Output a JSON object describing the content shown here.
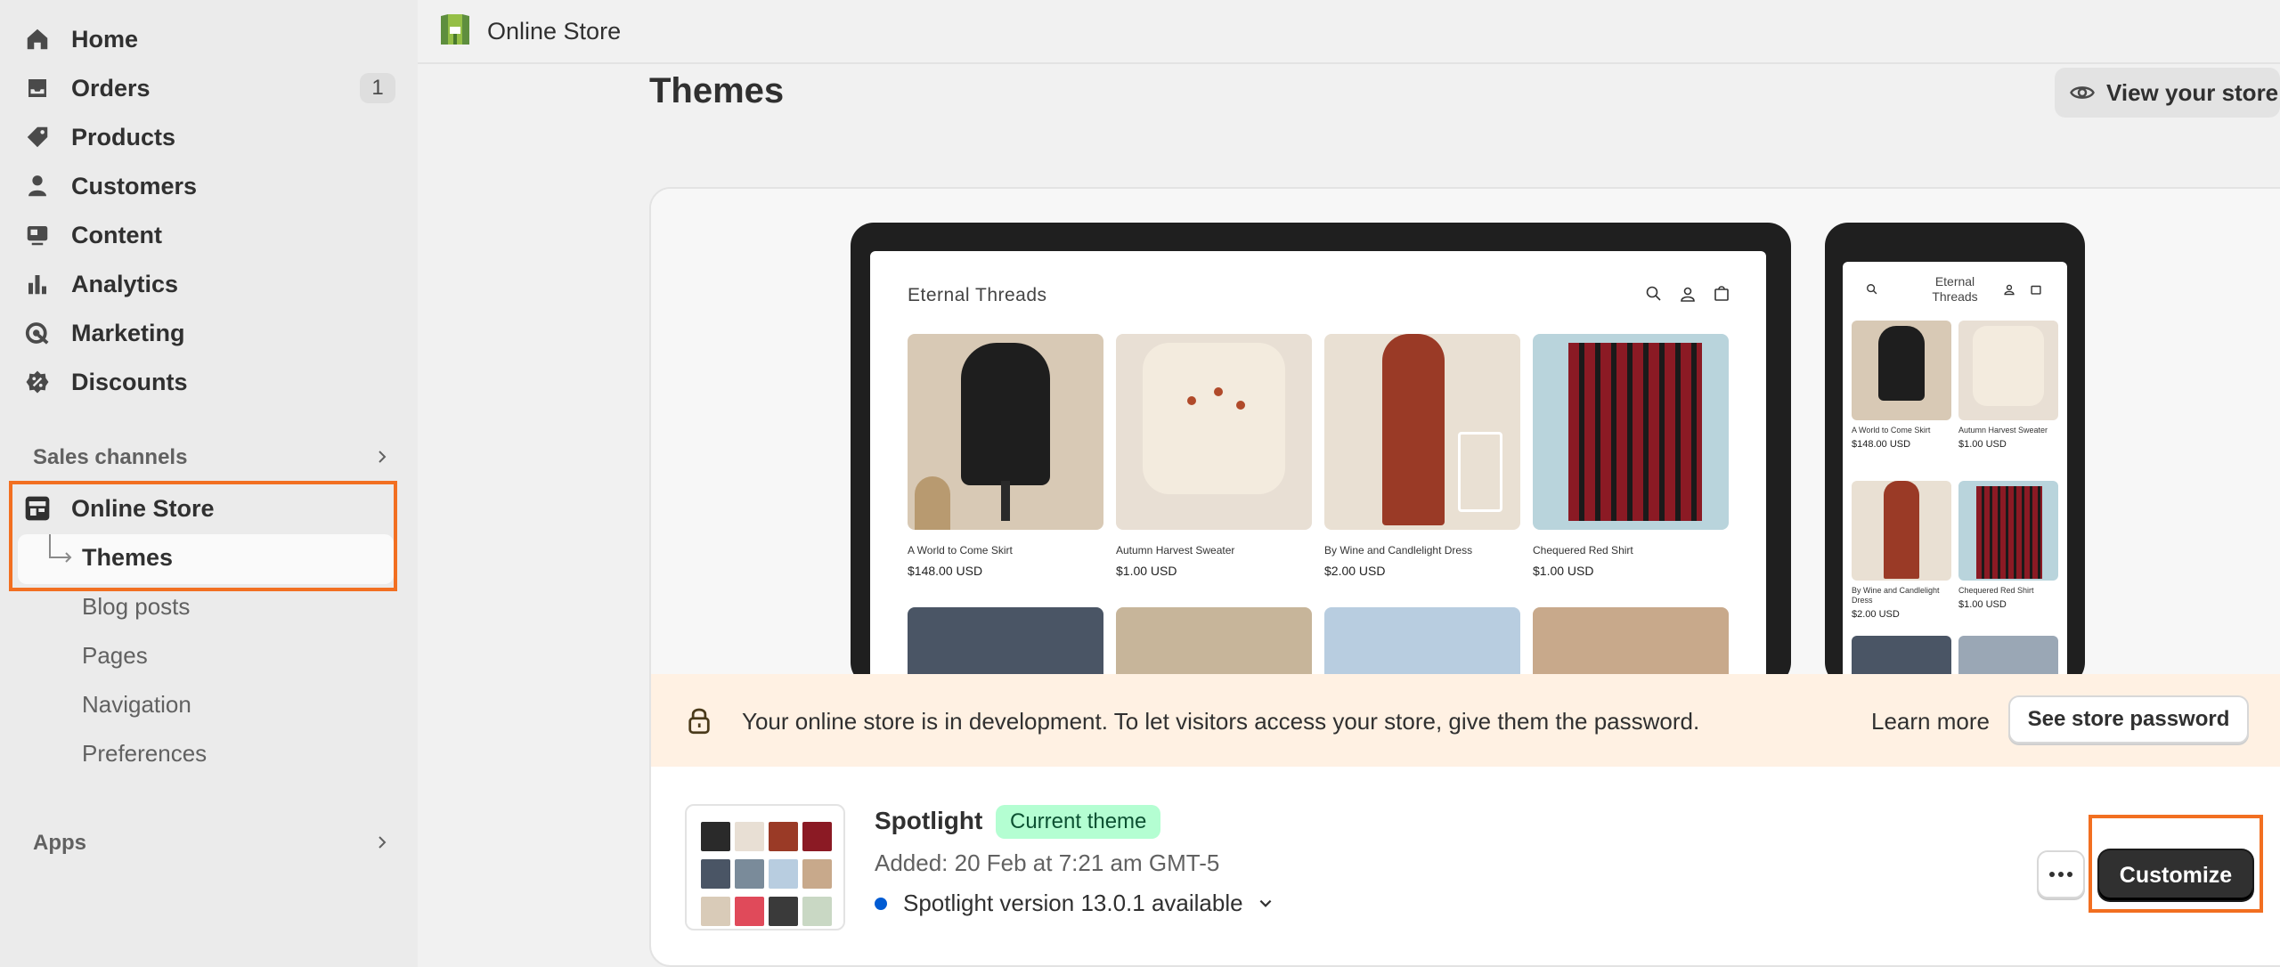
{
  "sidebar": {
    "nav": [
      {
        "label": "Home",
        "icon": "home-icon"
      },
      {
        "label": "Orders",
        "icon": "inbox-icon",
        "badge": "1"
      },
      {
        "label": "Products",
        "icon": "tag-icon"
      },
      {
        "label": "Customers",
        "icon": "person-icon"
      },
      {
        "label": "Content",
        "icon": "content-icon"
      },
      {
        "label": "Analytics",
        "icon": "bar-chart-icon"
      },
      {
        "label": "Marketing",
        "icon": "target-icon"
      },
      {
        "label": "Discounts",
        "icon": "discount-icon"
      }
    ],
    "sales_channels": "Sales channels",
    "online_store": "Online Store",
    "sub_items": [
      "Themes",
      "Blog posts",
      "Pages",
      "Navigation",
      "Preferences"
    ],
    "apps": "Apps"
  },
  "topbar": {
    "title": "Online Store"
  },
  "page": {
    "title": "Themes",
    "view_store": "View your store"
  },
  "preview": {
    "store_name": "Eternal Threads",
    "phone_store_name": "Eternal Threads",
    "products": [
      {
        "name": "A World to Come Skirt",
        "price": "$148.00 USD"
      },
      {
        "name": "Autumn Harvest Sweater",
        "price": "$1.00 USD"
      },
      {
        "name": "By Wine and Candlelight Dress",
        "price": "$2.00 USD"
      },
      {
        "name": "Chequered Red Shirt",
        "price": "$1.00 USD"
      }
    ]
  },
  "notice": {
    "message": "Your online store is in development. To let visitors access your store, give them the password.",
    "learn_more": "Learn more",
    "see_password": "See store password"
  },
  "theme": {
    "name": "Spotlight",
    "badge": "Current theme",
    "added": "Added: 20 Feb at 7:21 am GMT-5",
    "version": "Spotlight version 13.0.1 available",
    "customize": "Customize"
  },
  "colors": {
    "highlight": "#f26f21",
    "badge_bg": "#b4fed2",
    "notice_bg": "#fff1e3",
    "primary_button": "#303030",
    "version_dot": "#005bd3"
  }
}
